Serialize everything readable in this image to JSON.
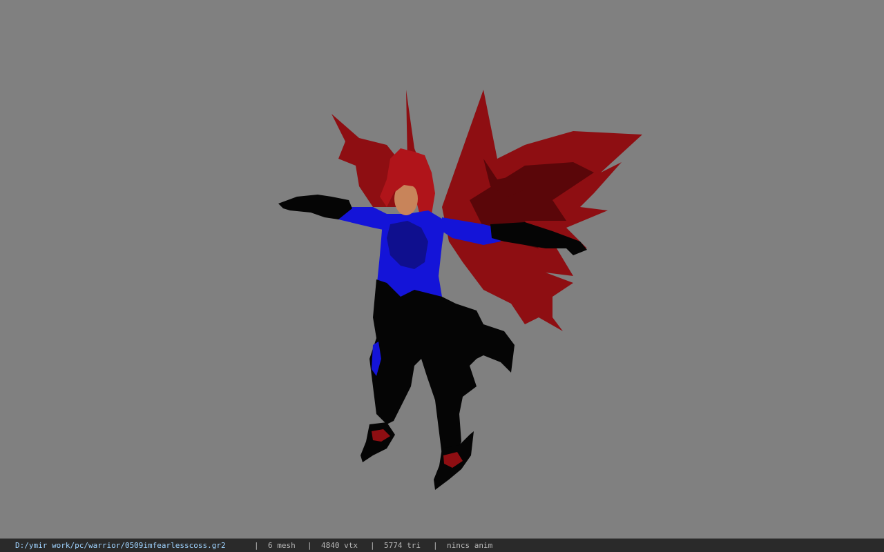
{
  "viewer": {
    "background_color": "#808080",
    "model": {
      "description_icon": "character-model-icon",
      "colors": {
        "wings": "#8e0e12",
        "wings_dark": "#5a0609",
        "hair": "#b0141a",
        "body": "#1414d8",
        "armor": "#050505",
        "skin": "#c8845a"
      }
    }
  },
  "statusbar": {
    "path": "D:/ymir work/pc/warrior/0509imfearlesscoss.gr2",
    "separator": "|",
    "mesh": "6 mesh",
    "vtx": "4840 vtx",
    "tri": "5774 tri",
    "anim": "nincs anim"
  }
}
